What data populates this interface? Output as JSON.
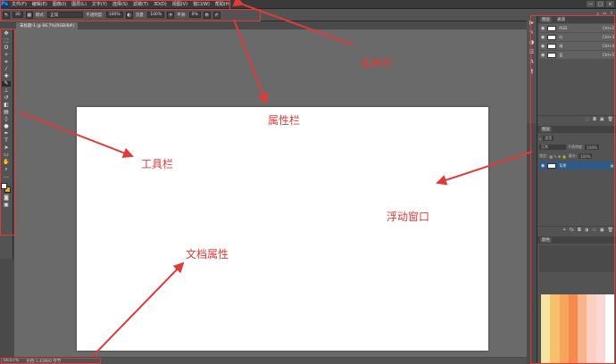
{
  "app": {
    "logo": "Ps"
  },
  "menubar": {
    "items": [
      "文件(F)",
      "编辑(E)",
      "图像(I)",
      "图层(L)",
      "文字(Y)",
      "选择(S)",
      "滤镜(T)",
      "3D(D)",
      "视图(V)",
      "窗口(W)",
      "帮助(H)"
    ],
    "window_controls": [
      "—",
      "□",
      "×"
    ]
  },
  "optionsbar": {
    "brush_size": "30",
    "mode_label": "模式:",
    "mode_value": "正常",
    "opacity_label": "不透明度:",
    "opacity_value": "100%",
    "flow_label": "流量:",
    "flow_value": "100%",
    "smooth_label": "平滑:",
    "smooth_value": "0%"
  },
  "document": {
    "tab_label": "未标题-1 @ 66.7%(RGB/8#)",
    "status_zoom": "66.67%",
    "status_info": "文档:1.43M/0 字节"
  },
  "panels": {
    "layers_tabs": [
      "图层",
      "通道"
    ],
    "channel_rows": [
      {
        "name": "RGB",
        "shortcut": "Ctrl+2"
      },
      {
        "name": "红",
        "shortcut": "Ctrl+3"
      },
      {
        "name": "绿",
        "shortcut": "Ctrl+4"
      },
      {
        "name": "蓝",
        "shortcut": "Ctrl+5"
      }
    ],
    "layers_title": "图层",
    "filter_kind": "类型",
    "blend_mode": "正常",
    "opacity_label": "不透明度:",
    "opacity_value": "100%",
    "lock_label": "锁定:",
    "fill_label": "填充:",
    "fill_value": "100%",
    "layer_rows": [
      {
        "name": "背景"
      }
    ],
    "color_title": "颜色"
  },
  "colors": {
    "accent": "#e03b3b",
    "foreground": "#ffffff",
    "background": "#e9a93a",
    "swatches": [
      "#f6e4a2",
      "#f5c26b",
      "#f7a55d",
      "#f6894d",
      "#f9b48a",
      "#fbd0c0",
      "#fcd7d7",
      "#ffffff"
    ]
  },
  "annotations": {
    "menubar": "菜单栏",
    "optionsbar": "属性栏",
    "toolbar": "工具栏",
    "floating": "浮动窗口",
    "docprops": "文档属性"
  }
}
